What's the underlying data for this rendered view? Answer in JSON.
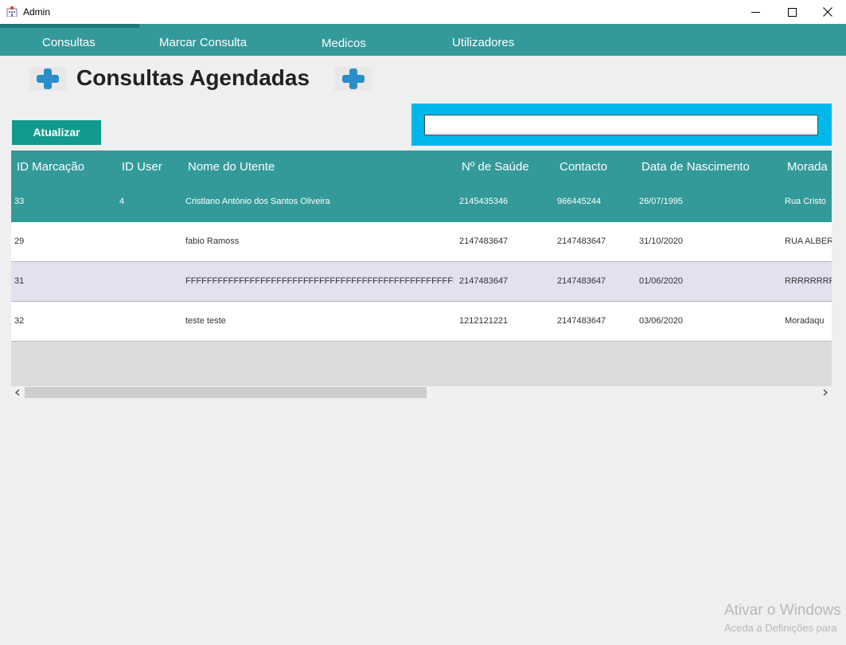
{
  "window": {
    "title": "Admin",
    "icon": "hospital-icon"
  },
  "nav": {
    "tabs": [
      {
        "label": "Consultas",
        "active": true
      },
      {
        "label": "Marcar Consulta"
      },
      {
        "label": "Medicos"
      },
      {
        "label": "Utilizadores"
      }
    ]
  },
  "header": {
    "title": "Consultas Agendadas",
    "icon": "plus-icon"
  },
  "toolbar": {
    "refresh_label": "Atualizar",
    "search_value": ""
  },
  "table": {
    "columns": [
      "ID Marcação",
      "ID User",
      "Nome do Utente",
      "Nº de Saúde",
      "Contacto",
      "Data de Nascimento",
      "Morada"
    ],
    "rows": [
      {
        "id_marcacao": "33",
        "id_user": "4",
        "nome": "Cristlano António dos Santos Oliveira",
        "n_saude": "2145435346",
        "contacto": "966445244",
        "data_nascimento": "26/07/1995",
        "morada": "Rua Cristo",
        "selected": true
      },
      {
        "id_marcacao": "29",
        "id_user": "",
        "nome": "fabio Ramoss",
        "n_saude": "2147483647",
        "contacto": "2147483647",
        "data_nascimento": "31/10/2020",
        "morada": "RUA ALBER"
      },
      {
        "id_marcacao": "31",
        "id_user": "",
        "nome": "FFFFFFFFFFFFFFFFFFFFFFFFFFFFFFFFFFFFFFFFFFFFFFFFFFFFFFFFFFFFF",
        "n_saude": "2147483647",
        "contacto": "2147483647",
        "data_nascimento": "01/06/2020",
        "morada": "RRRRRRRRR"
      },
      {
        "id_marcacao": "32",
        "id_user": "",
        "nome": "teste teste",
        "n_saude": "1212121221",
        "contacto": "2147483647",
        "data_nascimento": "03/06/2020",
        "morada": "Moradaqu"
      }
    ]
  },
  "watermark": {
    "title": "Ativar o Windows",
    "subtitle": "Aceda a Definições para"
  },
  "colors": {
    "teal": "#339999",
    "accent_blue": "#00b7eb",
    "button": "#129a8f",
    "alt_row": "#e3e0f0"
  }
}
